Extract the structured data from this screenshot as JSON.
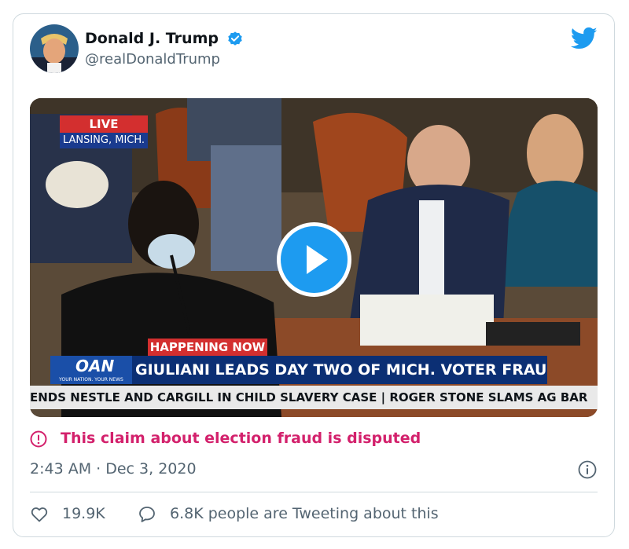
{
  "tweet": {
    "author_name": "Donald J. Trump",
    "handle": "@realDonaldTrump",
    "timestamp": "2:43 AM · Dec 3, 2020",
    "verified": true
  },
  "media": {
    "live_label": "LIVE",
    "location_label": "LANSING, MICH.",
    "happening_label": "HAPPENING NOW",
    "network_logo": "OAN",
    "network_slogan": "YOUR NATION. YOUR NEWS",
    "headline": "GIULIANI LEADS DAY TWO OF MICH. VOTER FRAUD HEARINGS",
    "ticker": "ENDS NESTLE AND CARGILL IN CHILD SLAVERY CASE  |  ROGER STONE SLAMS AG BAR",
    "play_icon": "play-icon"
  },
  "notice": {
    "icon": "alert-icon",
    "text": "This claim about election fraud is disputed"
  },
  "actions": {
    "like_icon": "heart-icon",
    "like_count": "19.9K",
    "reply_icon": "speech-bubble-icon",
    "reply_text": "6.8K people are Tweeting about this"
  },
  "colors": {
    "brand": "#1d9bf0",
    "disputed": "#d3216c",
    "secondary_text": "#536471",
    "headline_bar": "#0b2f74",
    "alert_red": "#d32f2f"
  }
}
